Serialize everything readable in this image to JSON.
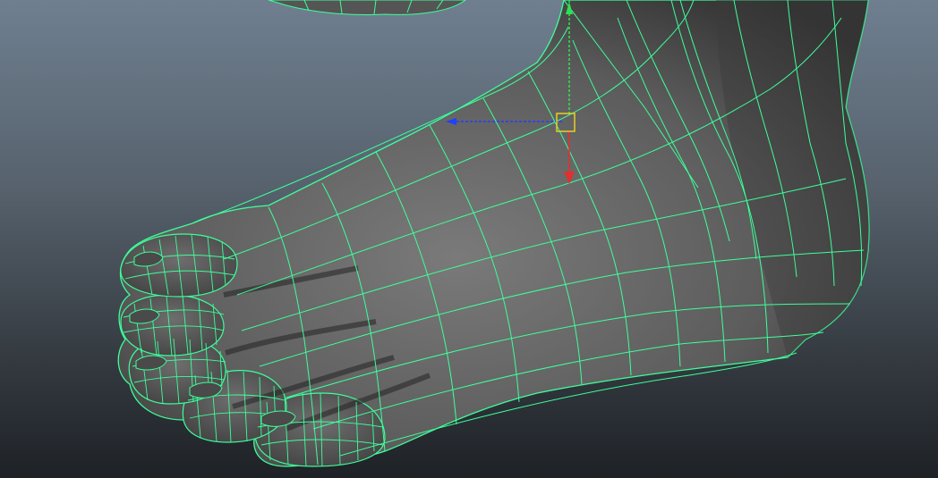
{
  "viewport": {
    "name": "perspective-viewport",
    "background_top": "#6f7f90",
    "background_bottom": "#1e2227"
  },
  "mesh": {
    "object": "foot",
    "wireframe_color": "#3dff9a",
    "shaded_color": "#6a6a6a",
    "selection_highlight": true
  },
  "manipulator": {
    "tool": "move",
    "axis_x_color": "#2040ff",
    "axis_y_color": "#30e050",
    "axis_z_color": "#e03030",
    "center_handle_color": "#e8d020"
  }
}
